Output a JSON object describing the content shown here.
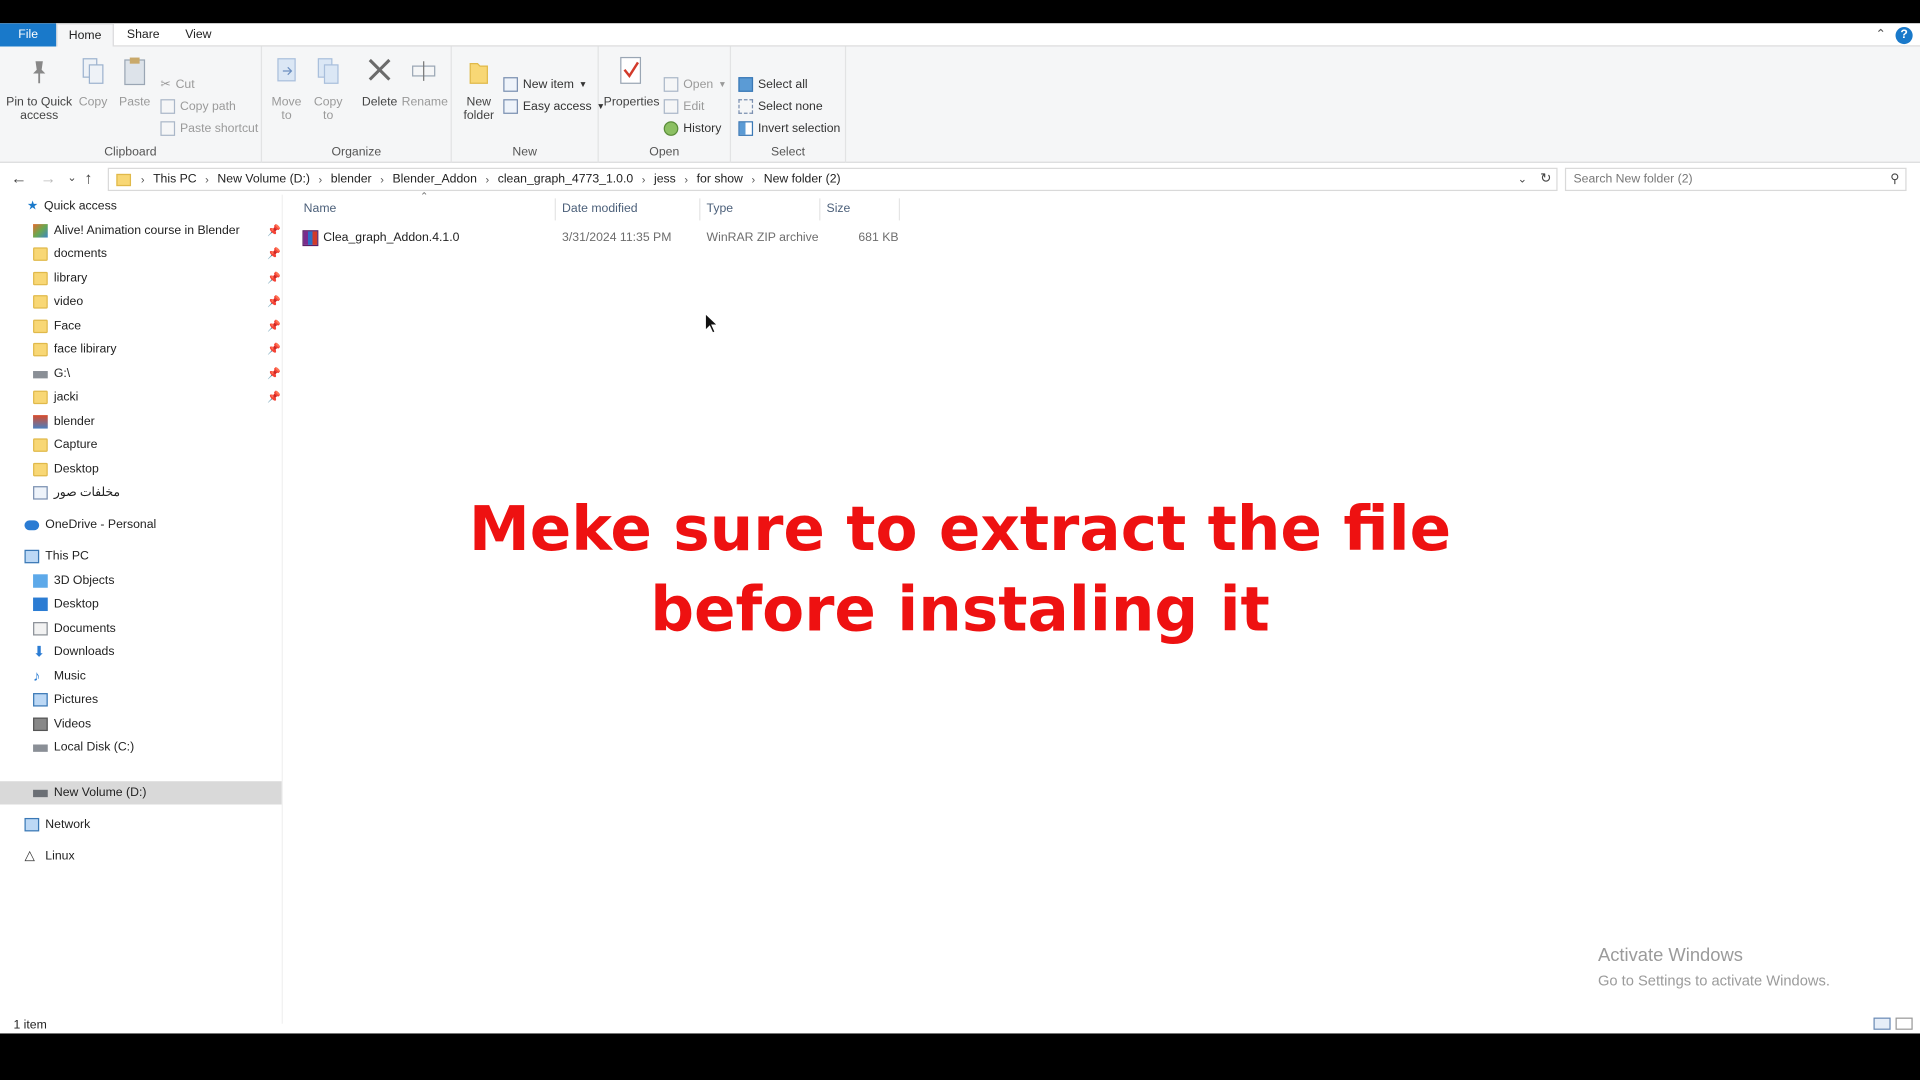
{
  "ribbon_tabs": {
    "file": "File",
    "home": "Home",
    "share": "Share",
    "view": "View"
  },
  "clipboard": {
    "pin": "Pin to Quick access",
    "copy": "Copy",
    "paste": "Paste",
    "cut": "Cut",
    "copy_path": "Copy path",
    "paste_shortcut": "Paste shortcut",
    "label": "Clipboard"
  },
  "organize": {
    "move_to": "Move to",
    "copy_to": "Copy to",
    "delete": "Delete",
    "rename": "Rename",
    "label": "Organize"
  },
  "new_group": {
    "new_folder": "New folder",
    "new_item": "New item",
    "easy_access": "Easy access",
    "label": "New"
  },
  "open_group": {
    "properties": "Properties",
    "open": "Open",
    "edit": "Edit",
    "history": "History",
    "label": "Open"
  },
  "select_group": {
    "select_all": "Select all",
    "select_none": "Select none",
    "invert": "Invert selection",
    "label": "Select"
  },
  "address": {
    "crumbs": [
      "This PC",
      "New Volume (D:)",
      "blender",
      "Blender_Addon",
      "clean_graph_4773_1.0.0",
      "jess",
      "for show",
      "New folder (2)"
    ],
    "search_placeholder": "Search New folder (2)"
  },
  "nav": {
    "quick_access": "Quick access",
    "quick_items": [
      "Alive! Animation course in Blender",
      "docments",
      "library",
      "video",
      "Face",
      "face libirary",
      "G:\\",
      "jacki",
      "blender",
      "Capture",
      "Desktop",
      "مخلفات صور"
    ],
    "onedrive": "OneDrive - Personal",
    "this_pc": "This PC",
    "pc_items": [
      "3D Objects",
      "Desktop",
      "Documents",
      "Downloads",
      "Music",
      "Pictures",
      "Videos",
      "Local Disk (C:)",
      "New Volume (D:)"
    ],
    "network": "Network",
    "linux": "Linux"
  },
  "columns": {
    "name": "Name",
    "date": "Date modified",
    "type": "Type",
    "size": "Size"
  },
  "files": [
    {
      "name": "Clea_graph_Addon.4.1.0",
      "date": "3/31/2024 11:35 PM",
      "type": "WinRAR ZIP archive",
      "size": "681 KB"
    }
  ],
  "overlay": {
    "line1": "Meke sure to extract the file",
    "line2": "before instaling it"
  },
  "watermark": {
    "title": "Activate Windows",
    "subtitle": "Go to Settings to activate Windows."
  },
  "status": "1 item",
  "colors": {
    "accent": "#1979ca",
    "overlay_text": "#ee1111",
    "folder": "#f8d775"
  }
}
